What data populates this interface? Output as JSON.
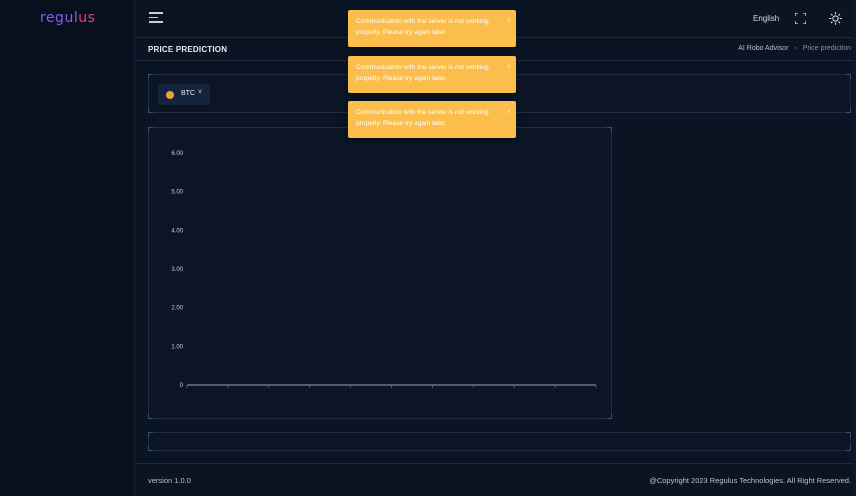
{
  "app": {
    "logo_text": "regul",
    "logo_tail": "us",
    "colors": {
      "background": "#0b1423",
      "toast": "#fbbd4c",
      "accent": "#8a5cf0",
      "brand_pink": "#e2417c",
      "coin": "#f0a23a"
    }
  },
  "header": {
    "menu_icon": "hamburger-icon",
    "language": "English",
    "fullscreen_icon": "fullscreen-icon",
    "theme_icon": "sun-icon"
  },
  "page": {
    "title": "PRICE PREDICTION",
    "breadcrumb": {
      "parent": "AI Robo Advisor",
      "separator": "›",
      "current": "Price prediction"
    }
  },
  "selector": {
    "coin": "BTC",
    "caret": "˅",
    "coin_icon": "bitcoin-icon"
  },
  "chart_data": {
    "type": "line",
    "y_ticks": [
      "0",
      "1.00",
      "2.00",
      "3.00",
      "4.00",
      "5.00",
      "6.00"
    ],
    "ylim": [
      0,
      6
    ],
    "x_categories": 10,
    "series": [],
    "grid": false
  },
  "toasts": [
    {
      "message": "Communication with the server is not working properly. Please try again later.",
      "close": "×"
    },
    {
      "message": "Communication with the server is not working properly. Please try again later.",
      "close": "×"
    },
    {
      "message": "Communication with the server is not working properly. Please try again later.",
      "close": "×"
    }
  ],
  "footer": {
    "version": "version 1.0.0",
    "copyright": "@Copyright 2023 Regulus Technologies. All Right Reserved."
  }
}
